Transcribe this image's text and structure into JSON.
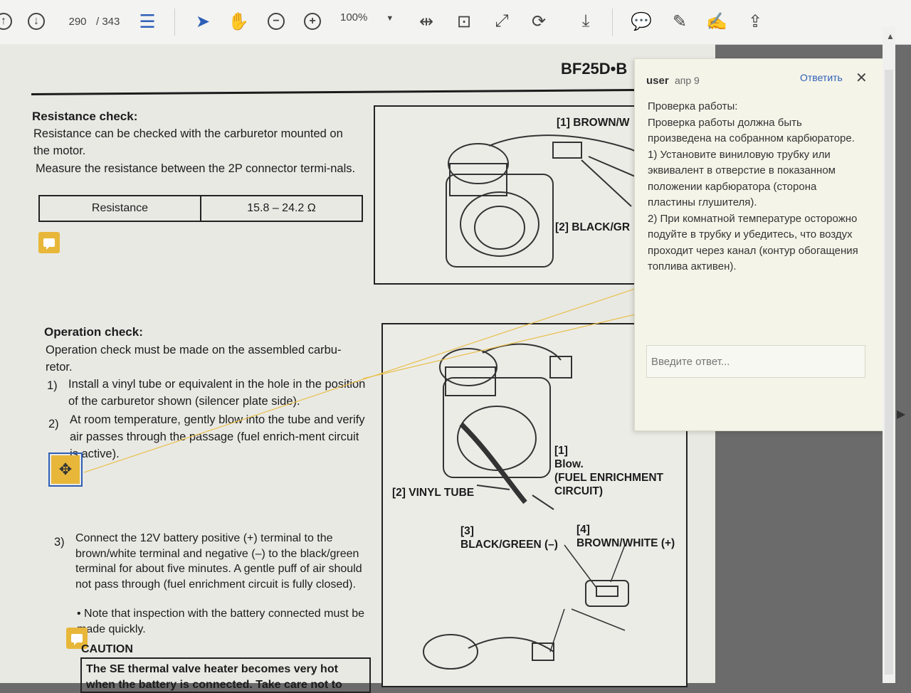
{
  "toolbar": {
    "page_current": "290",
    "page_total": "/ 343",
    "zoom": "100%",
    "icons": [
      "scroll-up-icon",
      "scroll-down-icon",
      "thumbnails-icon",
      "select-cursor-icon",
      "hand-icon",
      "zoom-out-icon",
      "zoom-in-icon",
      "zoom-dropdown-icon",
      "fit-width-icon",
      "fit-page-icon",
      "fullscreen-icon",
      "rotate-icon",
      "download-icon",
      "comment-icon",
      "highlight-icon",
      "sign-icon",
      "export-icon"
    ]
  },
  "document": {
    "header": "BF25D•B",
    "resistance": {
      "heading": "Resistance check:",
      "para1": "Resistance can be checked with the carburetor mounted on the motor.",
      "para2": "Measure the resistance between the 2P connector termi-nals.",
      "table_label": "Resistance",
      "table_value": "15.8 – 24.2 Ω"
    },
    "operation": {
      "heading": "Operation check:",
      "intro": "Operation check must be made on the assembled carbu-retor.",
      "step1_num": "1)",
      "step1": "Install a vinyl tube or equivalent in the hole in the position of the carburetor shown (silencer plate side).",
      "step2_num": "2)",
      "step2": "At room temperature, gently blow into the tube and verify air passes through the passage (fuel enrich-ment circuit is active).",
      "step3_num": "3)",
      "step3": "Connect the 12V battery positive (+) terminal to the brown/white terminal and negative (–) to the black/green terminal for about five minutes. A gentle puff of air should not pass through (fuel enrichment circuit is fully closed).",
      "bullet": "• Note that inspection with the battery connected must be made quickly.",
      "caution_title": "CAUTION",
      "caution_text": "The SE thermal valve heater becomes very hot when the battery is connected. Take care not to"
    },
    "figure1": {
      "label1": "[1] BROWN/W",
      "label2": "[2] BLACK/GR"
    },
    "figure2": {
      "label1": "[1]\nBlow.\n(FUEL ENRICHMENT\nCIRCUIT)",
      "label2": "[2] VINYL TUBE",
      "label3": "[3]\nBLACK/GREEN (–)",
      "label4": "[4]\nBROWN/WHITE (+)"
    }
  },
  "comment": {
    "author": "user",
    "date": "апр 9",
    "reply": "Ответить",
    "close": "✕",
    "body": "Проверка работы:\nПроверка работы должна быть произведена на собранном карбюраторе.\n1) Установите виниловую трубку или эквивалент в отверстие в показанном положении карбюратора (сторона пластины глушителя).\n2) При комнатной температуре осторожно подуйте в трубку и убедитесь, что воздух проходит через канал (контур обогащения топлива активен).",
    "reply_placeholder": "Введите ответ..."
  },
  "colors": {
    "note_icon": "#e8b73a",
    "link": "#2d5fb8",
    "comment_bg": "#f5f4e9",
    "connector_line": "#e8c04a"
  }
}
